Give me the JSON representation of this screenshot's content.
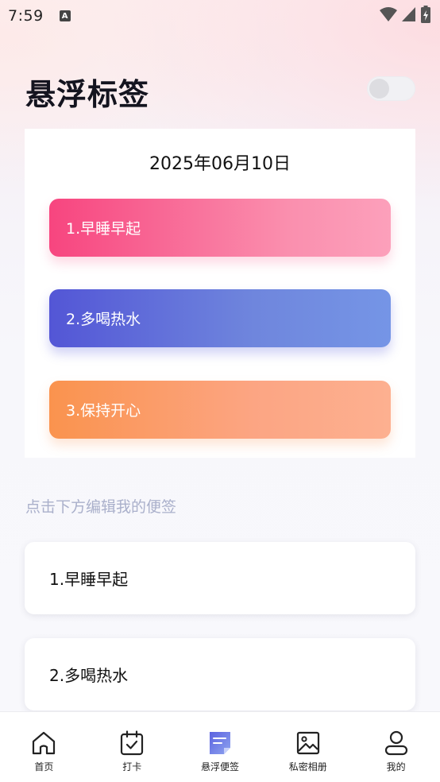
{
  "status_bar": {
    "time": "7:59",
    "notification_icon": "A"
  },
  "header": {
    "title": "悬浮标签",
    "toggle_on": false
  },
  "floating_card": {
    "date": "2025年06月10日",
    "tags": [
      {
        "label": "1.早睡早起",
        "colors": [
          "#f7457f",
          "#fca0bb"
        ]
      },
      {
        "label": "2.多喝热水",
        "colors": [
          "#5356d6",
          "#7595e6"
        ]
      },
      {
        "label": "3.保持开心",
        "colors": [
          "#fa934e",
          "#fdb090"
        ]
      }
    ]
  },
  "hint": "点击下方编辑我的便签",
  "notes": [
    {
      "label": "1.早睡早起"
    },
    {
      "label": "2.多喝热水"
    }
  ],
  "tabbar": {
    "active_index": 2,
    "accent_color": "#6b78e6",
    "items": [
      {
        "label": "首页",
        "icon": "home-icon"
      },
      {
        "label": "打卡",
        "icon": "calendar-check-icon"
      },
      {
        "label": "悬浮便签",
        "icon": "sticky-note-icon"
      },
      {
        "label": "私密相册",
        "icon": "photo-album-icon"
      },
      {
        "label": "我的",
        "icon": "profile-icon"
      }
    ]
  }
}
